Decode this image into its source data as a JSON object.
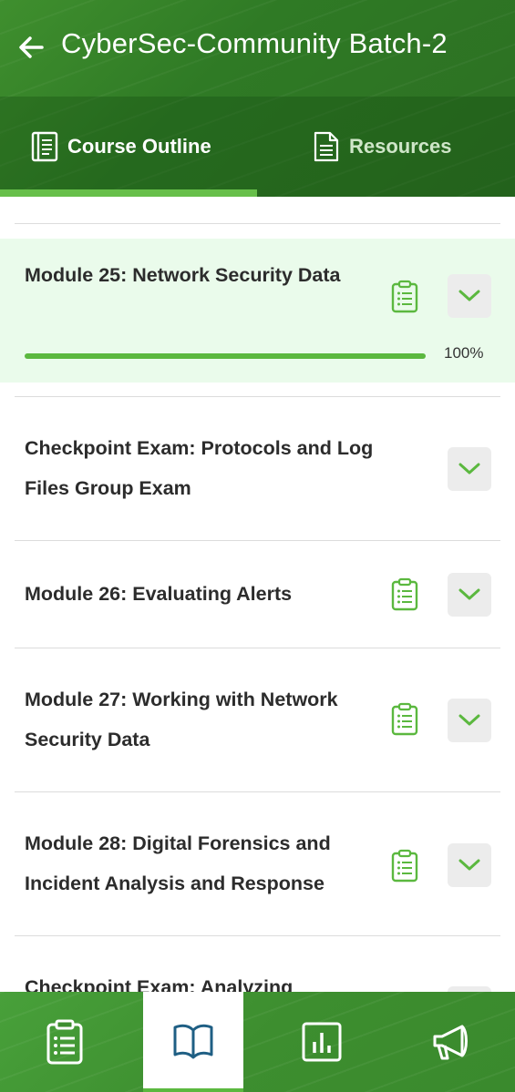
{
  "header": {
    "title": "CyberSec-Community Batch-2",
    "back_icon": "arrow-left-icon"
  },
  "tabs": [
    {
      "label": "Course Outline",
      "icon": "book-icon",
      "active": true
    },
    {
      "label": "Resources",
      "icon": "document-icon",
      "active": false
    }
  ],
  "modules": [
    {
      "title": "Module 25: Network Security Data",
      "has_assessment_icon": true,
      "expanded_state": "collapsed",
      "progress_percent": 100,
      "progress_label": "100%",
      "highlighted": true
    },
    {
      "title": "Checkpoint Exam: Protocols and Log Files Group Exam",
      "has_assessment_icon": false,
      "expanded_state": "collapsed"
    },
    {
      "title": "Module 26: Evaluating Alerts",
      "has_assessment_icon": true,
      "expanded_state": "collapsed"
    },
    {
      "title": "Module 27: Working with Network Security Data",
      "has_assessment_icon": true,
      "expanded_state": "collapsed"
    },
    {
      "title": "Module 28: Digital Forensics and Incident Analysis and Response",
      "has_assessment_icon": true,
      "expanded_state": "collapsed"
    },
    {
      "title": "Checkpoint Exam: Analyzing",
      "has_assessment_icon": false,
      "expanded_state": "collapsed"
    }
  ],
  "bottom_nav": [
    {
      "icon": "clipboard-list-icon",
      "selected": false
    },
    {
      "icon": "open-book-icon",
      "selected": true
    },
    {
      "icon": "bar-chart-icon",
      "selected": false
    },
    {
      "icon": "megaphone-icon",
      "selected": false
    }
  ],
  "colors": {
    "brand_green": "#3f8f2e",
    "accent_green": "#5bb83f",
    "active_row_bg": "#eafbeb"
  }
}
